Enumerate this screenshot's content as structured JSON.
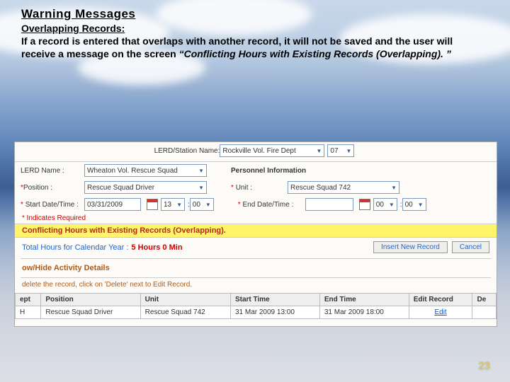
{
  "heading": "Warning Messages",
  "subheading": "Overlapping Records:",
  "body_pre": "If a record is entered that overlaps with another record, it will not be saved and the user will receive a message on the screen ",
  "body_msg": "“Conflicting Hours with Existing Records (Overlapping). ”",
  "form": {
    "station_label": "LERD/Station Name:",
    "station_value": "Rockville Vol. Fire Dept",
    "station_num": "07",
    "lerd_label": "LERD Name :",
    "lerd_value": "Wheaton Vol. Rescue Squad",
    "pi_label": "Personnel Information",
    "pos_label": "Position :",
    "pos_value": "Rescue Squad Driver",
    "unit_label": "Unit :",
    "unit_value": "Rescue Squad 742",
    "start_label": "Start Date/Time :",
    "start_date": "03/31/2009",
    "start_hh": "13",
    "start_mm": "00",
    "end_label": "End Date/Time :",
    "end_hh": "00",
    "end_mm": "00",
    "required": "* Indicates Required",
    "warn": "Conflicting Hours with Existing Records (Overlapping).",
    "total_label": "Total Hours for Calendar Year :",
    "total_value": "5 Hours 0 Min",
    "btn_insert": "Insert New Record",
    "btn_cancel": "Cancel",
    "section": "ow/Hide Activity Details",
    "help": "delete the record, click on 'Delete' next to Edit Record.",
    "th_dept": "ept",
    "th_pos": "Position",
    "th_unit": "Unit",
    "th_start": "Start Time",
    "th_end": "End Time",
    "th_edit": "Edit Record",
    "th_del": "De",
    "row_dept": "H",
    "row_pos": "Rescue Squad Driver",
    "row_unit": "Rescue Squad 742",
    "row_start": "31 Mar 2009 13:00",
    "row_end": "31 Mar 2009 18:00",
    "row_edit": "Edit"
  },
  "pagenum": "23"
}
